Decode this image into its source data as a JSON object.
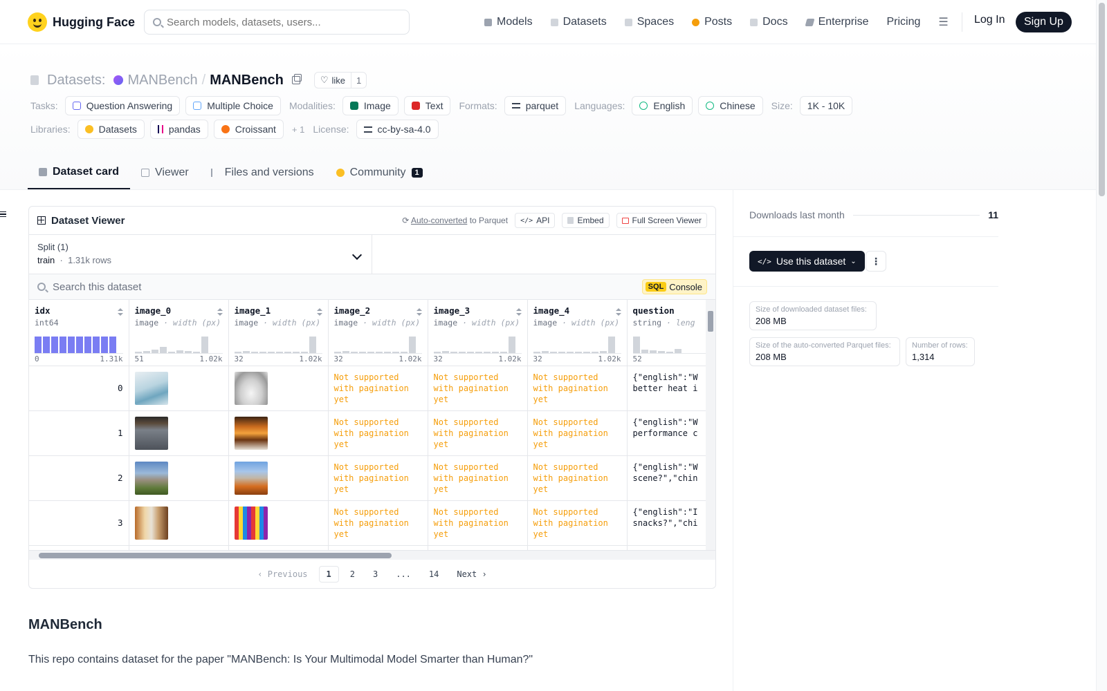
{
  "nav": {
    "logo_text": "Hugging Face",
    "search_placeholder": "Search models, datasets, users...",
    "links": [
      {
        "label": "Models",
        "icon": "models-icon",
        "color": "#6b7280"
      },
      {
        "label": "Datasets",
        "icon": "datasets-icon",
        "color": "#9ca3af"
      },
      {
        "label": "Spaces",
        "icon": "spaces-icon",
        "color": "#9ca3af"
      },
      {
        "label": "Posts",
        "icon": "posts-icon",
        "color": "#f59e0b"
      },
      {
        "label": "Docs",
        "icon": "docs-icon",
        "color": "#9ca3af"
      },
      {
        "label": "Enterprise",
        "icon": "enterprise-icon",
        "color": "#6b7280"
      },
      {
        "label": "Pricing",
        "icon": "",
        "color": ""
      }
    ],
    "login": "Log In",
    "signup": "Sign Up"
  },
  "header": {
    "prefix": "Datasets:",
    "org": "MANBench",
    "repo": "MANBench",
    "like_label": "like",
    "like_count": "1",
    "tasks_label": "Tasks:",
    "tasks": [
      "Question Answering",
      "Multiple Choice"
    ],
    "modalities_label": "Modalities:",
    "modalities": [
      "Image",
      "Text"
    ],
    "formats_label": "Formats:",
    "formats": [
      "parquet"
    ],
    "languages_label": "Languages:",
    "languages": [
      "English",
      "Chinese"
    ],
    "size_label": "Size:",
    "size": "1K - 10K",
    "libraries_label": "Libraries:",
    "libraries": [
      "Datasets",
      "pandas",
      "Croissant"
    ],
    "libraries_more": "+ 1",
    "license_label": "License:",
    "license": "cc-by-sa-4.0"
  },
  "tabs": [
    {
      "label": "Dataset card",
      "active": true
    },
    {
      "label": "Viewer",
      "active": false
    },
    {
      "label": "Files and versions",
      "active": false
    },
    {
      "label": "Community",
      "active": false,
      "badge": "1"
    }
  ],
  "viewer": {
    "title": "Dataset Viewer",
    "auto_converted": "Auto-converted",
    "to_parquet": "to Parquet",
    "api": "API",
    "embed": "Embed",
    "fullscreen": "Full Screen Viewer",
    "split_label": "Split (1)",
    "split_name": "train",
    "split_rows": "1.31k rows",
    "search_placeholder": "Search this dataset",
    "sql_tag": "SQL",
    "sql_console": "Console",
    "columns": [
      {
        "name": "idx",
        "type": "int64",
        "sub": "",
        "min": "0",
        "max": "1.31k"
      },
      {
        "name": "image_0",
        "type": "image",
        "sub": "· width (px)",
        "min": "51",
        "max": "1.02k"
      },
      {
        "name": "image_1",
        "type": "image",
        "sub": "· width (px)",
        "min": "32",
        "max": "1.02k"
      },
      {
        "name": "image_2",
        "type": "image",
        "sub": "· width (px)",
        "min": "32",
        "max": "1.02k"
      },
      {
        "name": "image_3",
        "type": "image",
        "sub": "· width (px)",
        "min": "32",
        "max": "1.02k"
      },
      {
        "name": "image_4",
        "type": "image",
        "sub": "· width (px)",
        "min": "32",
        "max": "1.02k"
      },
      {
        "name": "question",
        "type": "string",
        "sub": "· leng",
        "min": "52",
        "max": ""
      }
    ],
    "not_supported": "Not supported with pagination yet",
    "rows": [
      {
        "idx": "0",
        "question": "{\"english\":\"W\nbetter heat i"
      },
      {
        "idx": "1",
        "question": "{\"english\":\"W\nperformance c"
      },
      {
        "idx": "2",
        "question": "{\"english\":\"W\nscene?\",\"chin"
      },
      {
        "idx": "3",
        "question": "{\"english\":\"I\nsnacks?\",\"chi"
      }
    ],
    "pager": {
      "prev": "Previous",
      "pages": [
        "1",
        "2",
        "3",
        "...",
        "14"
      ],
      "next": "Next"
    }
  },
  "readme": {
    "heading": "MANBench",
    "text": "This repo contains dataset for the paper \"MANBench: Is Your Multimodal Model Smarter than Human?\""
  },
  "sidebar": {
    "downloads_label": "Downloads last month",
    "downloads": "11",
    "use_dataset": "Use this dataset",
    "stats": [
      {
        "label": "Size of downloaded dataset files:",
        "value": "208 MB"
      },
      {
        "label": "Size of the auto-converted Parquet files:",
        "value": "208 MB"
      },
      {
        "label": "Number of rows:",
        "value": "1,314"
      }
    ]
  }
}
